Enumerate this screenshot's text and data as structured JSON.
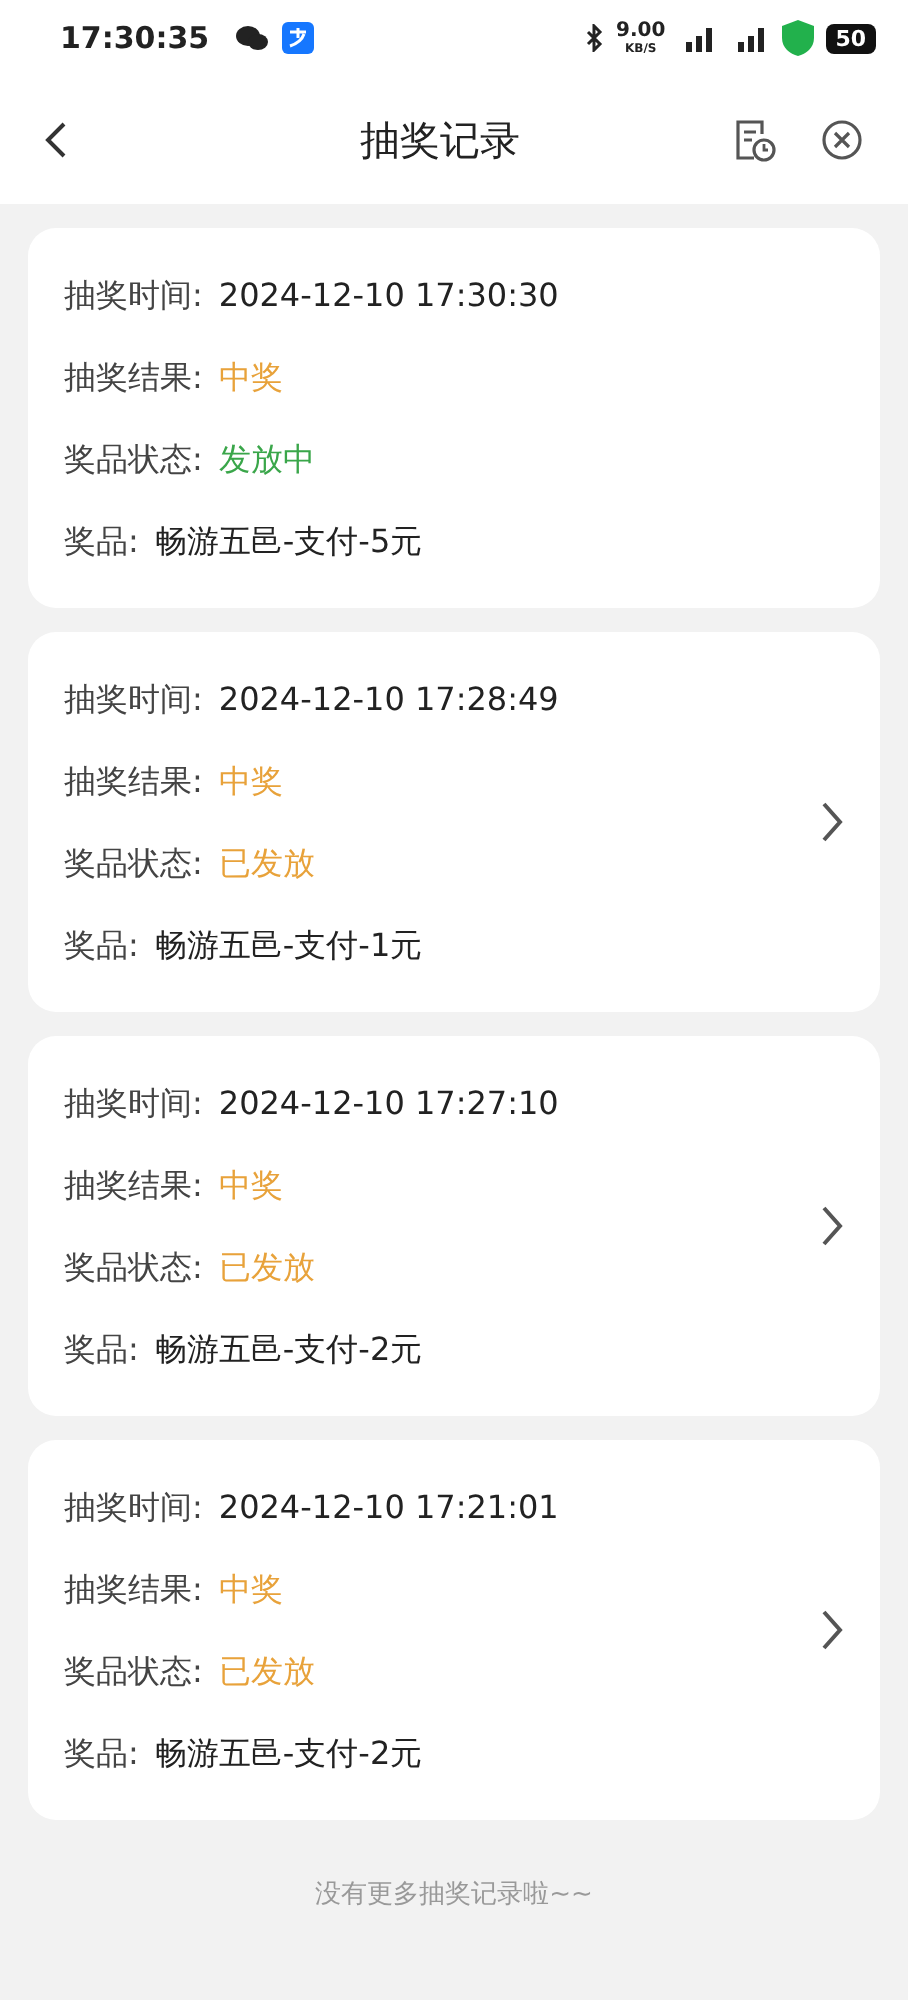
{
  "status_bar": {
    "time": "17:30:35",
    "speed": "9.00",
    "speed_unit": "KB/S",
    "battery": "50"
  },
  "header": {
    "title": "抽奖记录"
  },
  "records": [
    {
      "time_label": "抽奖时间:",
      "time": "2024-12-10 17:30:30",
      "result_label": "抽奖结果:",
      "result": "中奖",
      "status_label": "奖品状态:",
      "status": "发放中",
      "color": "#3aa64a",
      "prize_label": "奖品:",
      "prize": "畅游五邑-支付-5元",
      "has_arrow": false
    },
    {
      "time_label": "抽奖时间:",
      "time": "2024-12-10 17:28:49",
      "result_label": "抽奖结果:",
      "result": "中奖",
      "status_label": "奖品状态:",
      "status": "已发放",
      "color": "#e8a23a",
      "prize_label": "奖品:",
      "prize": "畅游五邑-支付-1元",
      "has_arrow": true
    },
    {
      "time_label": "抽奖时间:",
      "time": "2024-12-10 17:27:10",
      "result_label": "抽奖结果:",
      "result": "中奖",
      "status_label": "奖品状态:",
      "status": "已发放",
      "color": "#e8a23a",
      "prize_label": "奖品:",
      "prize": "畅游五邑-支付-2元",
      "has_arrow": true
    },
    {
      "time_label": "抽奖时间:",
      "time": "2024-12-10 17:21:01",
      "result_label": "抽奖结果:",
      "result": "中奖",
      "status_label": "奖品状态:",
      "status": "已发放",
      "color": "#e8a23a",
      "prize_label": "奖品:",
      "prize": "畅游五邑-支付-2元",
      "has_arrow": true
    }
  ],
  "footer": "没有更多抽奖记录啦~~"
}
